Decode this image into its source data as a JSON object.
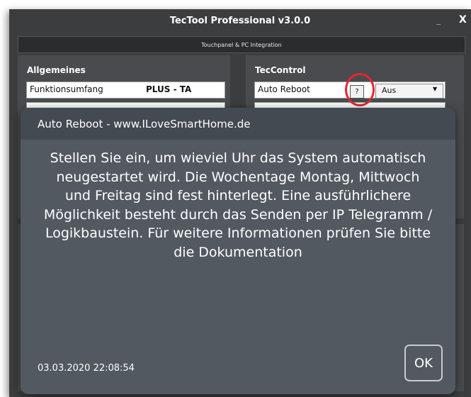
{
  "window": {
    "title": "TecTool Professional v3.0.0",
    "minimize_glyph": "_",
    "close_glyph": "X",
    "subtitle": "Touchpanel & PC Integration"
  },
  "allgemeines": {
    "title": "Allgemeines",
    "row_label": "Funktionsumfang",
    "row_value": "PLUS - TA"
  },
  "teccontrol": {
    "title": "TecControl",
    "row_label": "Auto Reboot",
    "help_label": "?",
    "select_value": "Aus"
  },
  "dialog": {
    "title": "Auto Reboot - www.ILoveSmartHome.de",
    "message": "Stellen Sie ein, um wieviel Uhr das System automatisch neugestartet wird. Die Wochentage Montag, Mittwoch und Freitag sind fest hinterlegt. Eine ausführlichere Möglichkeit besteht durch das Senden per IP Telegramm / Logikbaustein. Für weitere Informationen prüfen Sie bitte die Dokumentation",
    "timestamp": "03.03.2020 22:08:54",
    "ok_label": "OK"
  },
  "colors": {
    "window_bg": "#3c3d3f",
    "dialog_bg": "#525960",
    "highlight_circle": "#e4262f"
  }
}
